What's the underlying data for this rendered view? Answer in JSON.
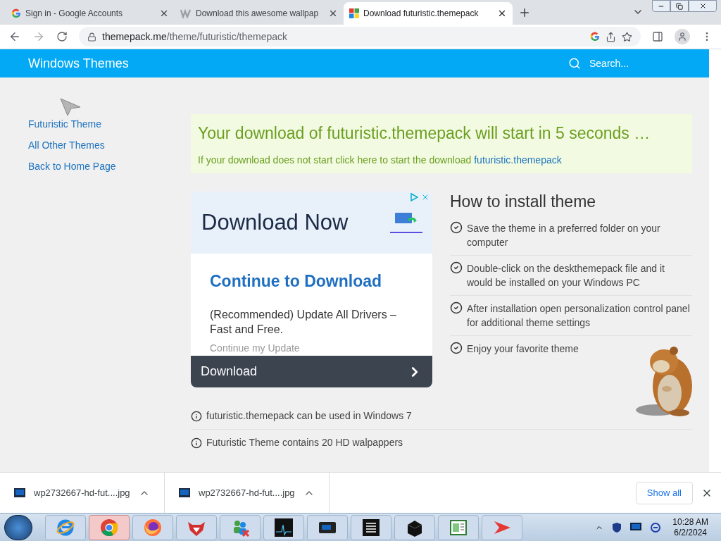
{
  "browser": {
    "tabs": [
      {
        "title": "Sign in - Google Accounts",
        "kind": "google",
        "selected": false
      },
      {
        "title": "Download this awesome wallpap",
        "kind": "w",
        "selected": false
      },
      {
        "title": "Download futuristic.themepack",
        "kind": "windows",
        "selected": true
      }
    ],
    "url": {
      "host": "themepack.me",
      "path": "/theme/futuristic/themepack"
    }
  },
  "header": {
    "title": "Windows Themes",
    "search_placeholder": "Search..."
  },
  "sidebar": {
    "links": [
      "Futuristic Theme",
      "All Other Themes",
      "Back to Home Page"
    ]
  },
  "notice": {
    "headline": "Your download of futuristic.themepack will start in 5 seconds …",
    "text": "If your download does not start click here to start the download",
    "link": "futuristic.themepack"
  },
  "ad": {
    "headline": "Download Now",
    "title": "Continue to Download",
    "body": "(Recommended) Update All Drivers – Fast and Free.",
    "faded": "Continue my Update",
    "button": "Download"
  },
  "install": {
    "title": "How to install theme",
    "steps": [
      "Save the theme in a preferred folder on your computer",
      "Double-click on the deskthemepack file and it would be installed on your Windows PC",
      "After installation open personalization control panel for additional theme settings",
      "Enjoy your favorite theme"
    ]
  },
  "info": [
    "futuristic.themepack can be used in Windows 7",
    "Futuristic Theme contains 20 HD walpappers"
  ],
  "downloads": {
    "items": [
      {
        "name": "wp2732667-hd-fut....jpg"
      },
      {
        "name": "wp2732667-hd-fut....jpg"
      }
    ],
    "show_all": "Show all"
  },
  "taskbar": {
    "apps": [
      {
        "kind": "ie",
        "selected": false
      },
      {
        "kind": "chrome",
        "selected": true
      },
      {
        "kind": "firefox",
        "selected": false
      },
      {
        "kind": "fox",
        "selected": false
      },
      {
        "kind": "people",
        "selected": false
      },
      {
        "kind": "pulse",
        "selected": false
      },
      {
        "kind": "screen",
        "selected": false
      },
      {
        "kind": "list",
        "selected": false
      },
      {
        "kind": "box",
        "selected": false
      },
      {
        "kind": "window",
        "selected": false
      },
      {
        "kind": "arrow",
        "selected": false
      }
    ],
    "time": "10:28 AM",
    "date": "6/2/2024"
  }
}
